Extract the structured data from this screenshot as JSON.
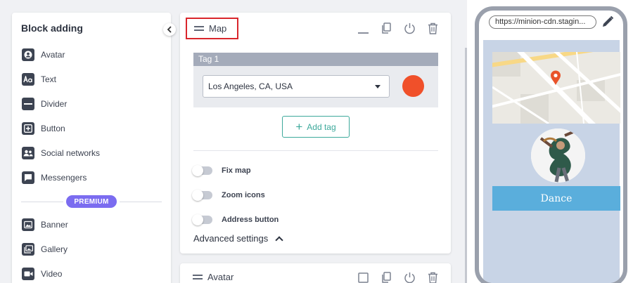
{
  "sidebar": {
    "title": "Block adding",
    "items": [
      {
        "label": "Avatar",
        "icon": "avatar-icon"
      },
      {
        "label": "Text",
        "icon": "text-icon"
      },
      {
        "label": "Divider",
        "icon": "divider-icon"
      },
      {
        "label": "Button",
        "icon": "button-icon"
      },
      {
        "label": "Social networks",
        "icon": "social-networks-icon"
      },
      {
        "label": "Messengers",
        "icon": "messengers-icon"
      }
    ],
    "premium_label": "PREMIUM",
    "premium_items": [
      {
        "label": "Banner",
        "icon": "banner-icon"
      },
      {
        "label": "Gallery",
        "icon": "gallery-icon"
      },
      {
        "label": "Video",
        "icon": "video-icon"
      }
    ]
  },
  "map_block": {
    "title": "Map",
    "tag_title": "Tag 1",
    "location_value": "Los Angeles, CA, USA",
    "tag_color": "#f0502a",
    "add_tag_label": "Add tag",
    "toggles": [
      {
        "label": "Fix map",
        "on": false
      },
      {
        "label": "Zoom icons",
        "on": false
      },
      {
        "label": "Address button",
        "on": false
      }
    ],
    "advanced_label": "Advanced settings"
  },
  "avatar_block": {
    "title": "Avatar"
  },
  "preview": {
    "url": "https://minion-cdn.stagin...",
    "button_label": "Dance",
    "accent": "#5aaedc"
  }
}
